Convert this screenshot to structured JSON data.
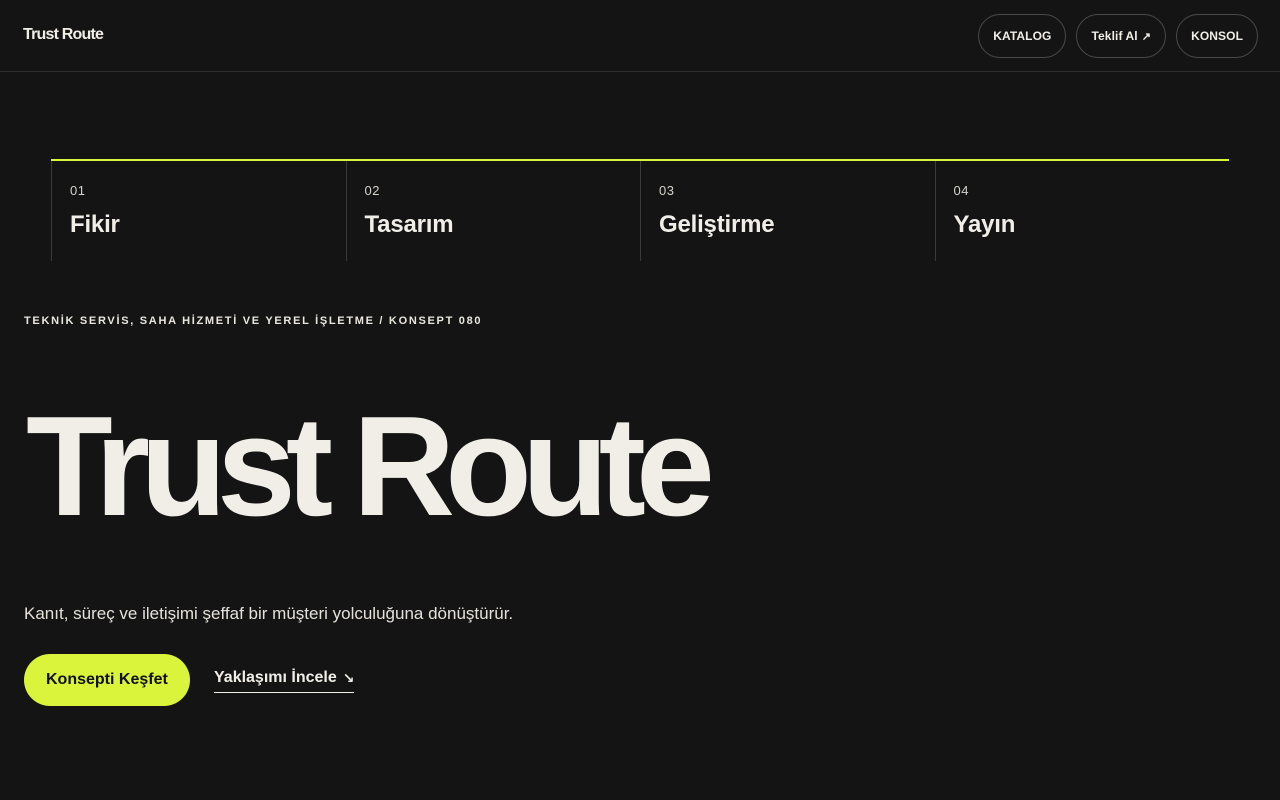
{
  "header": {
    "logo": "Trust Route",
    "nav": [
      {
        "label": "KATALOG"
      },
      {
        "label": "Teklif Al",
        "icon": "↗"
      },
      {
        "label": "KONSOL"
      }
    ]
  },
  "steps": [
    {
      "num": "01",
      "title": "Fikir"
    },
    {
      "num": "02",
      "title": "Tasarım"
    },
    {
      "num": "03",
      "title": "Geliştirme"
    },
    {
      "num": "04",
      "title": "Yayın"
    }
  ],
  "hero": {
    "eyebrow": "TEKNİK SERVİS, SAHA HİZMETİ VE YEREL İŞLETME / KONSEPT 080",
    "title": "Trust Route",
    "subtitle": "Kanıt, süreç ve iletişimi şeffaf bir müşteri yolculuğuna dönüştürür.",
    "cta_primary": "Konsepti Keşfet",
    "cta_secondary": "Yaklaşımı İncele",
    "cta_secondary_icon": "↘"
  },
  "colors": {
    "background": "#141414",
    "accent": "#d9f43a",
    "text": "#f1eee8"
  }
}
